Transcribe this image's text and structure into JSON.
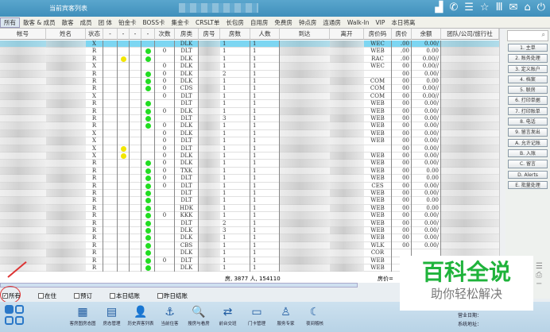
{
  "window": {
    "title": "当前宾客列表"
  },
  "title_icons": [
    "signal-icon",
    "phone-icon",
    "menu-icon",
    "star-icon",
    "columns-icon",
    "mail-icon",
    "home-icon",
    "power-icon"
  ],
  "tabs": [
    "所有",
    "散客 & 成员",
    "散客",
    "成员",
    "团 体",
    "铂金卡",
    "BOSS卡",
    "集金卡",
    "CRSLT单",
    "长包房",
    "自用房",
    "免费房",
    "钟点房",
    "连通房",
    "Walk-In",
    "VIP",
    "本日将离"
  ],
  "columns": [
    "帐号",
    "姓名",
    "状态",
    "-",
    "-",
    "-",
    "-",
    "次数",
    "房类",
    "房号",
    "房数",
    "人数",
    "到达",
    "离开",
    "房价码",
    "房价",
    "余额",
    "团队/公司/旅行社"
  ],
  "rows": [
    {
      "status": "X",
      "yellow": false,
      "green": false,
      "times": "",
      "type": "DLK",
      "rooms": "1",
      "people": "1",
      "code": "WEC",
      "price": ".00",
      "balance": "0.00/"
    },
    {
      "status": "R",
      "yellow": false,
      "green": true,
      "times": "0",
      "type": "DLT",
      "rooms": "1",
      "people": "1",
      "code": "WEB",
      "price": ".00",
      "balance": "0.00"
    },
    {
      "status": "R",
      "yellow": true,
      "green": true,
      "times": "",
      "type": "DLK",
      "rooms": "1",
      "people": "1",
      "code": "RAC",
      "price": ".00",
      "balance": "0.00//"
    },
    {
      "status": "X",
      "yellow": false,
      "green": false,
      "times": "0",
      "type": "DLK",
      "rooms": "1",
      "people": "1",
      "code": "WEC",
      "price": "00",
      "balance": "0.00//"
    },
    {
      "status": "R",
      "yellow": false,
      "green": true,
      "times": "0",
      "type": "DLK",
      "rooms": "2",
      "people": "1",
      "code": "",
      "price": "00",
      "balance": "0.00/"
    },
    {
      "status": "R",
      "yellow": false,
      "green": true,
      "times": "0",
      "type": "DLK",
      "rooms": "1",
      "people": "1",
      "code": "COM",
      "price": "00",
      "balance": "0.00"
    },
    {
      "status": "R",
      "yellow": false,
      "green": true,
      "times": "0",
      "type": "CDS",
      "rooms": "1",
      "people": "1",
      "code": "COM",
      "price": "00",
      "balance": "0.00//"
    },
    {
      "status": "X",
      "yellow": false,
      "green": false,
      "times": "0",
      "type": "DLT",
      "rooms": "1",
      "people": "1",
      "code": "COM",
      "price": "00",
      "balance": "0.00//"
    },
    {
      "status": "R",
      "yellow": false,
      "green": true,
      "times": "",
      "type": "DLT",
      "rooms": "1",
      "people": "1",
      "code": "WEB",
      "price": "00",
      "balance": "0.00/"
    },
    {
      "status": "R",
      "yellow": false,
      "green": true,
      "times": "0",
      "type": "DLK",
      "rooms": "1",
      "people": "1",
      "code": "WEB",
      "price": "00",
      "balance": "0.00/"
    },
    {
      "status": "R",
      "yellow": false,
      "green": true,
      "times": "",
      "type": "DLT",
      "rooms": "3",
      "people": "1",
      "code": "WEB",
      "price": "00",
      "balance": "0.00/"
    },
    {
      "status": "R",
      "yellow": false,
      "green": true,
      "times": "0",
      "type": "DLK",
      "rooms": "1",
      "people": "1",
      "code": "WEB",
      "price": "00",
      "balance": "0.00/"
    },
    {
      "status": "X",
      "yellow": false,
      "green": false,
      "times": "0",
      "type": "DLK",
      "rooms": "1",
      "people": "1",
      "code": "WEB",
      "price": "00",
      "balance": "0.00/"
    },
    {
      "status": "X",
      "yellow": false,
      "green": false,
      "times": "0",
      "type": "DLT",
      "rooms": "1",
      "people": "1",
      "code": "WEB",
      "price": "00",
      "balance": "0.00/"
    },
    {
      "status": "X",
      "yellow": true,
      "green": false,
      "times": "0",
      "type": "DLT",
      "rooms": "1",
      "people": "1",
      "code": "",
      "price": "00",
      "balance": "0.00/"
    },
    {
      "status": "X",
      "yellow": true,
      "green": false,
      "times": "0",
      "type": "DLK",
      "rooms": "1",
      "people": "1",
      "code": "WEB",
      "price": "00",
      "balance": "0.00/"
    },
    {
      "status": "R",
      "yellow": false,
      "green": true,
      "times": "0",
      "type": "DLK",
      "rooms": "1",
      "people": "1",
      "code": "WEB",
      "price": "00",
      "balance": "0.00/"
    },
    {
      "status": "R",
      "yellow": false,
      "green": true,
      "times": "0",
      "type": "TXK",
      "rooms": "1",
      "people": "1",
      "code": "WEB",
      "price": "00",
      "balance": "0.00"
    },
    {
      "status": "R",
      "yellow": false,
      "green": true,
      "times": "0",
      "type": "DLT",
      "rooms": "1",
      "people": "1",
      "code": "WEB",
      "price": "00",
      "balance": "0.00"
    },
    {
      "status": "R",
      "yellow": false,
      "green": true,
      "times": "0",
      "type": "DLT",
      "rooms": "1",
      "people": "1",
      "code": "CES",
      "price": "00",
      "balance": "0.00/"
    },
    {
      "status": "R",
      "yellow": false,
      "green": true,
      "times": "",
      "type": "DLT",
      "rooms": "1",
      "people": "1",
      "code": "WEB",
      "price": "00",
      "balance": "0.00/"
    },
    {
      "status": "R",
      "yellow": false,
      "green": true,
      "times": "",
      "type": "DLT",
      "rooms": "1",
      "people": "1",
      "code": "WEB",
      "price": "00",
      "balance": "0.00"
    },
    {
      "status": "R",
      "yellow": false,
      "green": true,
      "times": "",
      "type": "HDK",
      "rooms": "1",
      "people": "1",
      "code": "WEB",
      "price": "00",
      "balance": "0.00"
    },
    {
      "status": "R",
      "yellow": false,
      "green": true,
      "times": "0",
      "type": "KKK",
      "rooms": "1",
      "people": "1",
      "code": "WEB",
      "price": "00",
      "balance": "0.00/"
    },
    {
      "status": "R",
      "yellow": false,
      "green": true,
      "times": "",
      "type": "DLT",
      "rooms": "2",
      "people": "1",
      "code": "WEB",
      "price": "00",
      "balance": "0.00/"
    },
    {
      "status": "R",
      "yellow": false,
      "green": true,
      "times": "",
      "type": "DLK",
      "rooms": "3",
      "people": "1",
      "code": "WEB",
      "price": "00",
      "balance": "0.00/"
    },
    {
      "status": "R",
      "yellow": false,
      "green": true,
      "times": "",
      "type": "DLK",
      "rooms": "1",
      "people": "1",
      "code": "WEB",
      "price": "00",
      "balance": "0.00/"
    },
    {
      "status": "R",
      "yellow": false,
      "green": true,
      "times": "",
      "type": "CBS",
      "rooms": "1",
      "people": "1",
      "code": "WLK",
      "price": "00",
      "balance": "0.00/"
    },
    {
      "status": "R",
      "yellow": false,
      "green": true,
      "times": "",
      "type": "DLK",
      "rooms": "1",
      "people": "1",
      "code": "COR",
      "price": "",
      "balance": ""
    },
    {
      "status": "R",
      "yellow": false,
      "green": true,
      "times": "0",
      "type": "DLT",
      "rooms": "1",
      "people": "1",
      "code": "WEB",
      "price": "",
      "balance": ""
    },
    {
      "status": "R",
      "yellow": false,
      "green": true,
      "times": "",
      "type": "DLK",
      "rooms": "1",
      "people": "1",
      "code": "WEB",
      "price": "",
      "balance": ""
    }
  ],
  "summary": {
    "text": "房, 3877 人, 154110",
    "price_label": "房价="
  },
  "side": {
    "search_icon": "⌕",
    "buttons": [
      "1. 主单",
      "2. 账务处理",
      "3. 定义账户",
      "4. 档案",
      "5. 联房",
      "6. 打印单据",
      "7. 打印账单",
      "8. 电话",
      "9. 留言发出",
      "A. 允许记账",
      "B. 入账",
      "C. 留言",
      "D. Alerts",
      "E. 批量处理"
    ]
  },
  "filters": [
    {
      "label": "所有",
      "checked": true
    },
    {
      "label": "在住",
      "checked": false
    },
    {
      "label": "预订",
      "checked": false
    },
    {
      "label": "本日结账",
      "checked": false
    },
    {
      "label": "昨日结账",
      "checked": false
    }
  ],
  "toolbar": [
    {
      "label": "客房图房态图",
      "icon": "▦"
    },
    {
      "label": "房态管理",
      "icon": "▤"
    },
    {
      "label": "历史宾客列表",
      "icon": "👤"
    },
    {
      "label": "当前住客",
      "icon": "⚓"
    },
    {
      "label": "搜房与看房",
      "icon": "🔍"
    },
    {
      "label": "前台交班",
      "icon": "⇄"
    },
    {
      "label": "门卡管理",
      "icon": "▭"
    },
    {
      "label": "服务专家",
      "icon": "♙"
    },
    {
      "label": "夜间稽核",
      "icon": "☾"
    }
  ],
  "sysinfo": {
    "business_date_label": "营业日期：",
    "system_addr_label": "系统地址："
  },
  "watermark": {
    "title": "百科全说",
    "subtitle": "助你轻松解决"
  },
  "colors": {
    "title_bar": "#4a9bc4",
    "selected_row": "#7dd6f2",
    "green_dot": "#22dd22",
    "yellow_dot": "#f2e600",
    "watermark": "#1fb33b"
  }
}
